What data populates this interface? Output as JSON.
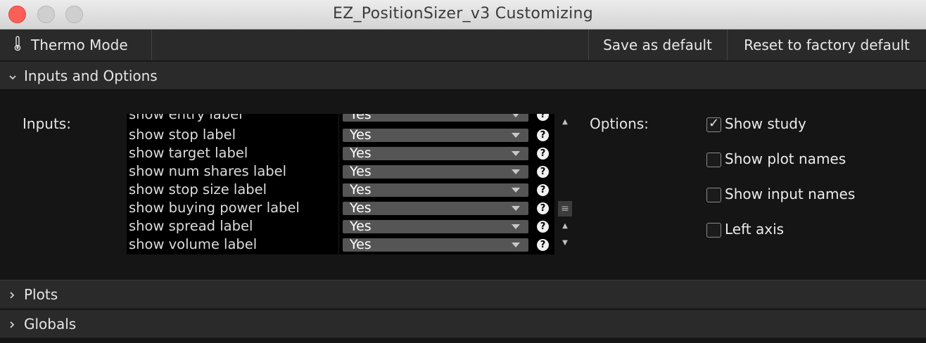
{
  "window": {
    "title": "EZ_PositionSizer_v3 Customizing"
  },
  "toolbar": {
    "thermo_label": "Thermo Mode",
    "save_label": "Save as default",
    "reset_label": "Reset to factory default"
  },
  "sections": {
    "inputs_options": "Inputs and Options",
    "plots": "Plots",
    "globals": "Globals"
  },
  "inputs": {
    "label": "Inputs:",
    "rows": [
      {
        "name": "show entry label",
        "value": "Yes"
      },
      {
        "name": "show stop label",
        "value": "Yes"
      },
      {
        "name": "show target label",
        "value": "Yes"
      },
      {
        "name": "show num shares label",
        "value": "Yes"
      },
      {
        "name": "show stop size label",
        "value": "Yes"
      },
      {
        "name": "show buying power label",
        "value": "Yes"
      },
      {
        "name": "show spread label",
        "value": "Yes"
      },
      {
        "name": "show volume label",
        "value": "Yes"
      }
    ]
  },
  "options": {
    "label": "Options:",
    "items": [
      {
        "label": "Show study",
        "checked": true
      },
      {
        "label": "Show plot names",
        "checked": false
      },
      {
        "label": "Show input names",
        "checked": false
      },
      {
        "label": "Left axis",
        "checked": false
      }
    ]
  },
  "icons": {
    "help": "?",
    "scroll_thumb": "≡"
  }
}
